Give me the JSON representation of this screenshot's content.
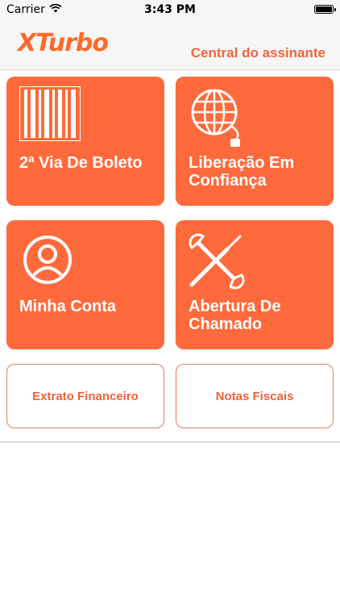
{
  "status_bar": {
    "carrier": "Carrier",
    "time": "3:43 PM"
  },
  "header": {
    "logo_text": "XTurbo",
    "title": "Central do assinante"
  },
  "tiles": [
    {
      "label": "2ª Via De Boleto",
      "icon": "barcode-icon"
    },
    {
      "label": "Liberação Em Confiança",
      "icon": "globe-network-icon"
    },
    {
      "label": "Minha Conta",
      "icon": "user-icon"
    },
    {
      "label": "Abertura De Chamado",
      "icon": "tools-icon"
    }
  ],
  "buttons": [
    {
      "label": "Extrato Financeiro"
    },
    {
      "label": "Notas Fiscais"
    }
  ],
  "colors": {
    "accent": "#ff6a3d",
    "header_bg": "#f6f6f6",
    "text_accent": "#ef6238"
  }
}
